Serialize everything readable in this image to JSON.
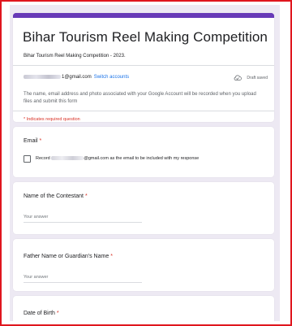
{
  "form": {
    "title": "Bihar Tourism Reel Making Competition",
    "description": "Bihar Tourism Reel Making Competition - 2023.",
    "account": {
      "email_domain": "1@gmail.com",
      "switch_label": "Switch accounts",
      "draft_status": "Draft saved"
    },
    "notice": "The name, email address and photo associated with your Google Account will be recorded when you upload files and submit this form",
    "required_note": "* Indicates required question"
  },
  "questions": {
    "email": {
      "label": "Email",
      "required_mark": "*",
      "checkbox_prefix": "Record",
      "checkbox_suffix": "@gmail.com as the email to be included with my response"
    },
    "contestant_name": {
      "label": "Name of the Contestant",
      "required_mark": "*",
      "placeholder": "Your answer"
    },
    "father_name": {
      "label": "Father Name or Guardian's Name",
      "required_mark": "*",
      "placeholder": "Your answer"
    },
    "dob": {
      "label": "Date of Birth",
      "required_mark": "*"
    }
  },
  "colors": {
    "accent": "#673ab7",
    "background": "#ede9f3",
    "required": "#d93025",
    "link": "#1a73e8",
    "frame_border": "#e0161e"
  },
  "icons": {
    "draft": "cloud-check-icon"
  }
}
